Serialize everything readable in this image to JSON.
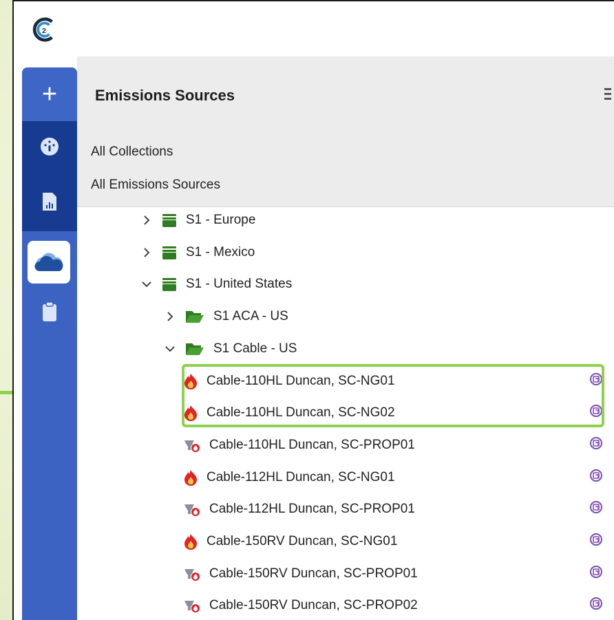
{
  "app": {
    "logo_text": "C2"
  },
  "sidebar": {
    "add_label": "+",
    "items": [
      {
        "icon": "dashboard-gauge-icon"
      },
      {
        "icon": "report-chart-icon"
      },
      {
        "icon": "cloud-icon",
        "active": true
      },
      {
        "icon": "clipboard-icon"
      }
    ]
  },
  "panel": {
    "title": "Emissions Sources",
    "links": [
      "All Collections",
      "All Emissions Sources"
    ]
  },
  "tree": [
    {
      "label": "S1 - Europe",
      "expanded": false,
      "type": "collection"
    },
    {
      "label": "S1 - Mexico",
      "expanded": false,
      "type": "collection"
    },
    {
      "label": "S1 - United States",
      "expanded": true,
      "type": "collection"
    },
    {
      "label": "S1 ACA - US",
      "expanded": false,
      "type": "folder"
    },
    {
      "label": "S1 Cable - US",
      "expanded": true,
      "type": "folder"
    },
    {
      "label": "Cable-110HL Duncan, SC-NG01",
      "type": "flame"
    },
    {
      "label": "Cable-110HL Duncan, SC-NG02",
      "type": "flame"
    },
    {
      "label": "Cable-110HL Duncan, SC-PROP01",
      "type": "propane"
    },
    {
      "label": "Cable-112HL Duncan, SC-NG01",
      "type": "flame"
    },
    {
      "label": "Cable-112HL Duncan, SC-PROP01",
      "type": "propane"
    },
    {
      "label": "Cable-150RV Duncan, SC-NG01",
      "type": "flame"
    },
    {
      "label": "Cable-150RV Duncan, SC-PROP01",
      "type": "propane"
    },
    {
      "label": "Cable-150RV Duncan, SC-PROP02",
      "type": "propane"
    }
  ],
  "colors": {
    "sidebar": "#3c63c1",
    "sidebar_dark": "#173b90",
    "collection_green": "#2e7d1f",
    "flame_red": "#e0242b",
    "highlight_green": "#8fd14f",
    "right_icon_purple": "#7b4bb0"
  }
}
